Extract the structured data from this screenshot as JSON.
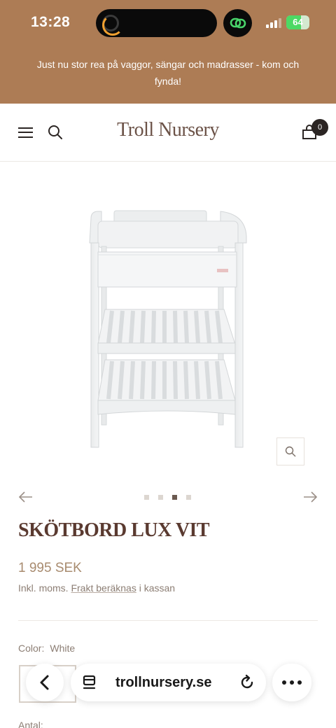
{
  "status_bar": {
    "time": "13:28",
    "battery": "64",
    "battery_level": 0.64,
    "signal_bars": 3
  },
  "banner": {
    "text": "Just nu stor rea på vaggor, sängar och madrasser - kom och fynda!"
  },
  "header": {
    "logo": "Troll Nursery",
    "cart_count": "0",
    "icons": [
      "menu-icon",
      "search-icon",
      "cart-icon"
    ]
  },
  "gallery": {
    "image": "white changing table with drawer and two slatted shelves",
    "slide_count": 4,
    "active_slide": 3,
    "icons": [
      "zoom-icon",
      "arrow-left-icon",
      "arrow-right-icon"
    ]
  },
  "product": {
    "title": "SKÖTBORD LUX VIT",
    "price": "1 995 SEK",
    "tax_prefix": "Inkl. moms.",
    "shipping_link": "Frakt beräknas",
    "tax_suffix": "i kassan",
    "color_label": "Color:",
    "color_value": "White",
    "quantity_label": "Antal:"
  },
  "browser": {
    "url": "trollnursery.se",
    "icons": [
      "back-icon",
      "tabs-icon",
      "reload-icon",
      "more-icon"
    ]
  },
  "colors": {
    "brand_brown": "#ad7c55",
    "title_brown": "#5a3a30",
    "price_tan": "#a88b6f"
  }
}
